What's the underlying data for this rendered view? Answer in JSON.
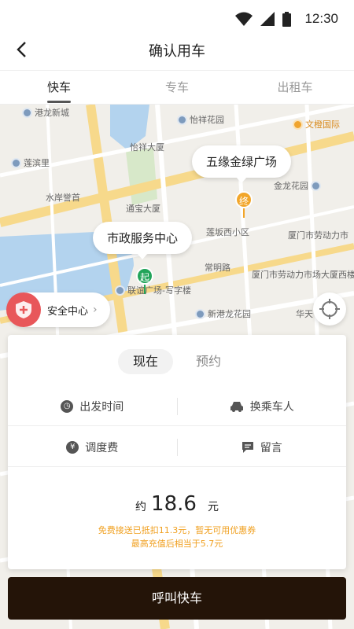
{
  "status_bar": {
    "time": "12:30"
  },
  "header": {
    "title": "确认用车"
  },
  "tabs": [
    {
      "label": "快车",
      "active": true
    },
    {
      "label": "专车",
      "active": false
    },
    {
      "label": "出租车",
      "active": false
    }
  ],
  "map": {
    "pois": [
      {
        "label": "港龙新城",
        "color": "blue"
      },
      {
        "label": "怡祥花园",
        "color": "blue"
      },
      {
        "label": "文橙国际",
        "color": "orange"
      },
      {
        "label": "怡祥大厦",
        "color": "blue"
      },
      {
        "label": "莲滨里",
        "color": "blue"
      },
      {
        "label": "金龙花园",
        "color": "blue"
      },
      {
        "label": "水岸誉首",
        "color": "blue"
      },
      {
        "label": "通宝大厦",
        "color": "blue"
      },
      {
        "label": "莲坂西小区",
        "color": "blue"
      },
      {
        "label": "厦门市劳动力市",
        "color": "blue"
      },
      {
        "label": "常明路",
        "color": "gray"
      },
      {
        "label": "厦门市劳动力市场大厦西楼",
        "color": "blue"
      },
      {
        "label": "联谊广场-写字楼",
        "color": "blue"
      },
      {
        "label": "新港龙花园",
        "color": "blue"
      },
      {
        "label": "华天",
        "color": "blue"
      }
    ],
    "destination_label": "五缘金绿广场",
    "destination_marker": "终",
    "origin_label": "市政服务中心",
    "origin_marker": "起",
    "colors": {
      "origin": "#22a45a",
      "destination": "#f2a62a",
      "water": "#b3d3ee",
      "road_main": "#f7d98b"
    }
  },
  "safety": {
    "label": "安全中心",
    "chevron": "›"
  },
  "panel": {
    "modes": [
      {
        "label": "现在",
        "active": true
      },
      {
        "label": "预约",
        "active": false
      }
    ],
    "options": {
      "departure_time": "出发时间",
      "change_passenger": "换乘车人",
      "dispatch_fee": "调度费",
      "message": "留言"
    },
    "price": {
      "prefix": "约",
      "amount": "18.6",
      "unit": "元"
    },
    "notes": [
      "免费接送已抵扣11.3元，暂无可用优惠券",
      "最高充值后相当于5.7元"
    ]
  },
  "cta": {
    "label": "呼叫快车",
    "color": "#241408"
  }
}
